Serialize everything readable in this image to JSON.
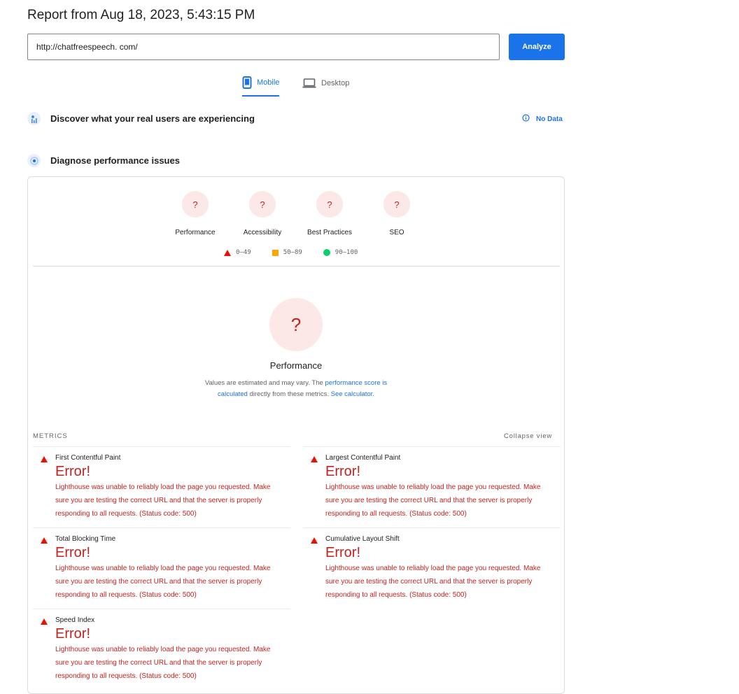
{
  "header": {
    "title": "Report from Aug 18, 2023, 5:43:15 PM"
  },
  "search": {
    "url_value": "http://chatfreespeech. com/",
    "analyze_label": "Analyze"
  },
  "tabs": [
    {
      "label": "Mobile",
      "active": true
    },
    {
      "label": "Desktop",
      "active": false
    }
  ],
  "field_data": {
    "title": "Discover what your real users are experiencing",
    "status": "No Data"
  },
  "lab_data": {
    "title": "Diagnose performance issues"
  },
  "categories": [
    {
      "label": "Performance",
      "score": "?"
    },
    {
      "label": "Accessibility",
      "score": "?"
    },
    {
      "label": "Best Practices",
      "score": "?"
    },
    {
      "label": "SEO",
      "score": "?"
    }
  ],
  "legend": {
    "fail": "0–49",
    "average": "50–89",
    "pass": "90–100"
  },
  "performance": {
    "score": "?",
    "title": "Performance",
    "note_prefix": "Values are estimated and may vary. The ",
    "note_link1": "performance score is calculated",
    "note_middle": " directly from these metrics. ",
    "note_link2": "See calculator."
  },
  "metrics": {
    "heading": "METRICS",
    "collapse_label": "Collapse view",
    "items": [
      {
        "name": "First Contentful Paint",
        "value": "Error!",
        "message": "Lighthouse was unable to reliably load the page you requested. Make sure you are testing the correct URL and that the server is properly responding to all requests. (Status code: 500)"
      },
      {
        "name": "Largest Contentful Paint",
        "value": "Error!",
        "message": "Lighthouse was unable to reliably load the page you requested. Make sure you are testing the correct URL and that the server is properly responding to all requests. (Status code: 500)"
      },
      {
        "name": "Total Blocking Time",
        "value": "Error!",
        "message": "Lighthouse was unable to reliably load the page you requested. Make sure you are testing the correct URL and that the server is properly responding to all requests. (Status code: 500)"
      },
      {
        "name": "Cumulative Layout Shift",
        "value": "Error!",
        "message": "Lighthouse was unable to reliably load the page you requested. Make sure you are testing the correct URL and that the server is properly responding to all requests. (Status code: 500)"
      },
      {
        "name": "Speed Index",
        "value": "Error!",
        "message": "Lighthouse was unable to reliably load the page you requested. Make sure you are testing the correct URL and that the server is properly responding to all requests. (Status code: 500)"
      }
    ]
  },
  "colors": {
    "accent": "#1a73e8",
    "fail": "#eb0f00",
    "average": "#ffa400",
    "pass": "#0cce6b",
    "error_text": "#c5221f"
  }
}
